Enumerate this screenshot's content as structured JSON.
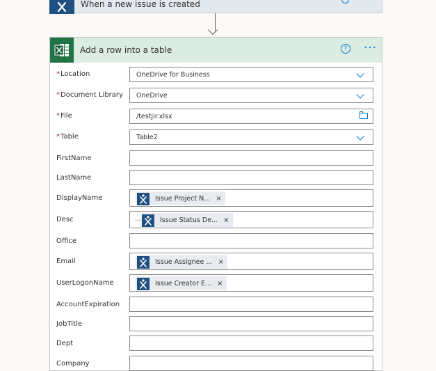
{
  "trigger": {
    "title": "When a new issue is created"
  },
  "action": {
    "title": "Add a row into a table",
    "help_icon": "?",
    "more_icon": "···"
  },
  "fields": [
    {
      "label": "Location",
      "required": "*",
      "value": "OneDrive for Business",
      "control": "dropdown"
    },
    {
      "label": "Document Library",
      "required": "*",
      "value": "OneDrive",
      "control": "dropdown"
    },
    {
      "label": "File",
      "required": "*",
      "value": "/testjir.xlsx",
      "control": "file-picker"
    },
    {
      "label": "Table",
      "required": "*",
      "value": "Table2",
      "control": "dropdown"
    },
    {
      "label": "FirstName",
      "value": ""
    },
    {
      "label": "LastName",
      "value": ""
    },
    {
      "label": "DisplayName",
      "token": "Issue Project N...",
      "token_close": "×"
    },
    {
      "label": "Desc",
      "prefix": "...",
      "token": "Issue Status De...",
      "token_close": "×"
    },
    {
      "label": "Office",
      "value": ""
    },
    {
      "label": "Email",
      "token": "Issue Assignee ...",
      "token_close": "×"
    },
    {
      "label": "UserLogonName",
      "token": "Issue Creator E...",
      "token_close": "×",
      "suffix": ","
    },
    {
      "label": "AccountExpiration",
      "value": ""
    },
    {
      "label": "JobTitle",
      "value": ""
    },
    {
      "label": "Dept",
      "value": ""
    },
    {
      "label": "Company",
      "value": ""
    }
  ],
  "colors": {
    "jira_blue": "#205081",
    "excel_green": "#217346",
    "header_bg": "#dbede3",
    "accent": "#0078d4",
    "required": "#a4262c"
  }
}
